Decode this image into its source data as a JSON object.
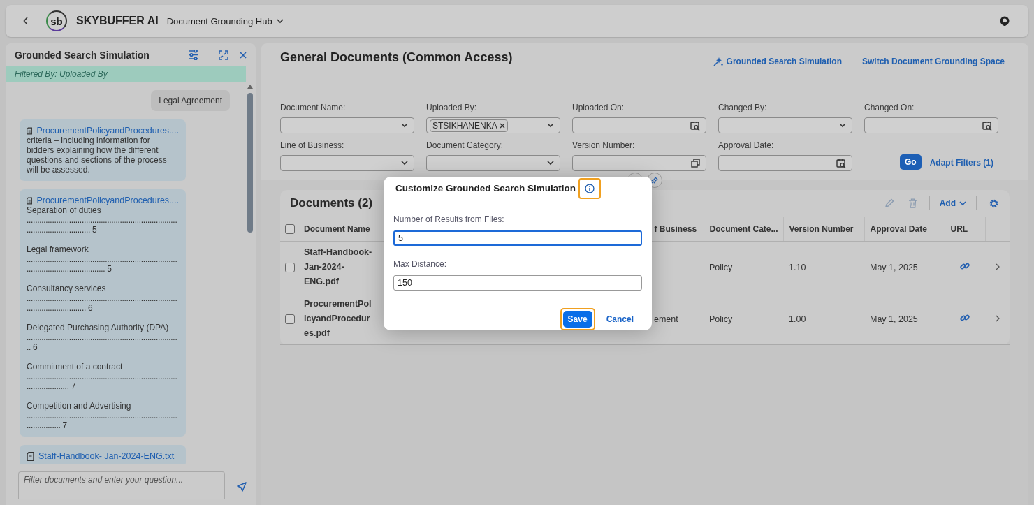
{
  "header": {
    "logo_text": "sb",
    "brand": "SKYBUFFER AI",
    "app_title": "Document Grounding Hub"
  },
  "side_panel": {
    "title": "Grounded Search Simulation",
    "filter_info": "Filtered By: Uploaded By",
    "messages": [
      {
        "kind": "user",
        "text": "Legal Agreement"
      },
      {
        "kind": "result",
        "file": "ProcurementPolicyandProcedures....",
        "entries": [
          {
            "text": "criteria – including information for bidders explaining how the different questions and sections of the process will be assessed."
          }
        ]
      },
      {
        "kind": "result",
        "file": "ProcurementPolicyandProcedures....",
        "entries": [
          {
            "text": "Separation of duties",
            "leader": "..................................................................................................... 5"
          },
          {
            "text": "Legal framework",
            "leader": "............................................................................................................ 5"
          },
          {
            "text": "Consultancy services",
            "leader": "................................................................................................... 6"
          },
          {
            "text": "Delegated Purchasing Authority (DPA)",
            "leader": "......................................................................... 6"
          },
          {
            "text": "Commitment of a contract",
            "leader": "........................................................................................... 7"
          },
          {
            "text": "Competition and Advertising",
            "leader": "....................................................................................... 7"
          }
        ]
      },
      {
        "kind": "result",
        "file": "Staff-Handbook- Jan-2024-ENG.txt"
      }
    ],
    "input": {
      "placeholder": "Filter documents and enter your question..."
    }
  },
  "page": {
    "title": "General Documents (Common Access)",
    "actions": [
      {
        "label": "Grounded Search Simulation",
        "kind": "sparkle"
      },
      {
        "label": "Switch Document Grounding Space",
        "kind": "plain"
      }
    ],
    "filters": [
      {
        "label": "Document Name:",
        "kind": "select"
      },
      {
        "label": "Uploaded By:",
        "kind": "select",
        "tokens": [
          "STSIKHANENKA"
        ]
      },
      {
        "label": "Uploaded On:",
        "kind": "date"
      },
      {
        "label": "Changed By:",
        "kind": "select"
      },
      {
        "label": "Changed On:",
        "kind": "date"
      },
      {
        "label": "Line of Business:",
        "kind": "select"
      },
      {
        "label": "Document Category:",
        "kind": "select"
      },
      {
        "label": "Version Number:",
        "kind": "copy"
      },
      {
        "label": "Approval Date:",
        "kind": "date"
      }
    ],
    "go_button": "Go",
    "adapt_filters": "Adapt Filters (1)"
  },
  "table": {
    "title": "Documents (2)",
    "add_button": "Add",
    "select_all_checked": false,
    "columns": [
      "Document Name",
      "f Business",
      "Document Cate...",
      "Version Number",
      "Approval Date",
      "URL"
    ],
    "rows": [
      {
        "checked": false,
        "document_name": "Staff-Handbook-Jan-2024-ENG.pdf",
        "category": "Policy",
        "version": "1.10",
        "approval_date": "May 1, 2025"
      },
      {
        "checked": false,
        "document_name": "ProcurementPolicyandProcedures.pdf",
        "column_3": "ement",
        "category": "Policy",
        "version": "1.00",
        "approval_date": "May 1, 2025"
      }
    ]
  },
  "dialog": {
    "title": "Customize Grounded Search Simulation",
    "info_highlighted": true,
    "fields": [
      {
        "label": "Number of Results from Files:",
        "value": "5",
        "focused": true
      },
      {
        "label": "Max Distance:",
        "value": "150",
        "focused": false
      }
    ],
    "buttons": [
      {
        "label": "Save",
        "kind": "primary",
        "highlighted": true
      },
      {
        "label": "Cancel",
        "kind": "link",
        "highlighted": false
      }
    ]
  }
}
